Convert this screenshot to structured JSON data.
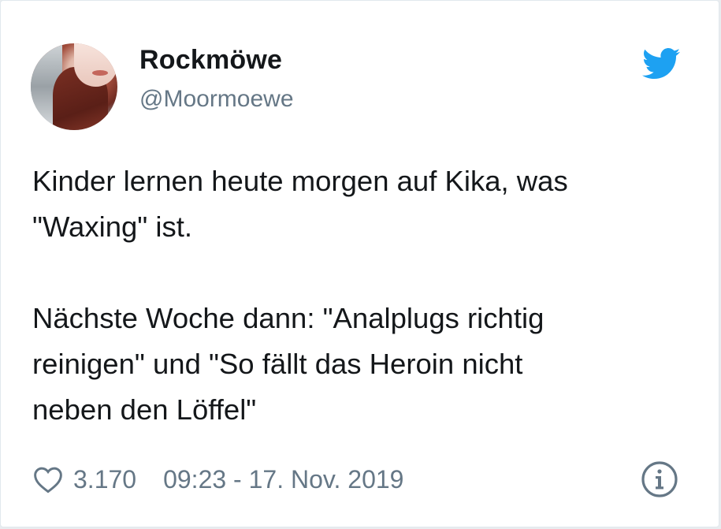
{
  "user": {
    "display_name": "Rockmöwe",
    "handle": "@Moormoewe"
  },
  "tweet": {
    "lines": [
      "Kinder lernen heute morgen auf Kika, was",
      "\"Waxing\" ist.",
      "Nächste Woche dann: \"Analplugs richtig",
      "reinigen\" und \"So fällt das Heroin nicht",
      "neben den Löffel\""
    ]
  },
  "footer": {
    "likes": "3.170",
    "timestamp": "09:23 - 17. Nov. 2019"
  },
  "icons": {
    "brand": "twitter-bird-icon",
    "like": "heart-icon",
    "info": "info-icon"
  },
  "colors": {
    "twitter_blue": "#1da1f2",
    "text": "#14171a",
    "secondary": "#657786"
  }
}
